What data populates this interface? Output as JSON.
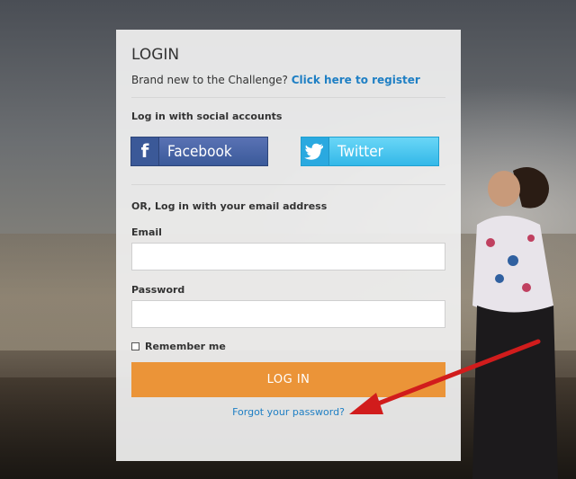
{
  "login": {
    "title": "LOGIN",
    "subtitle_prefix": "Brand new to the Challenge?",
    "register_link": "Click here to register",
    "social_label": "Log in with social accounts",
    "facebook_label": "Facebook",
    "twitter_label": "Twitter",
    "email_section_label": "OR, Log in with your email address",
    "email_label": "Email",
    "email_value": "",
    "password_label": "Password",
    "password_value": "",
    "remember_label": "Remember me",
    "login_button": "LOG IN",
    "forgot_link": "Forgot your password?"
  },
  "colors": {
    "accent_orange": "#eb9438",
    "link_blue": "#1e7fc4",
    "facebook_blue": "#3b5998",
    "twitter_blue": "#33b8e8",
    "annotation_arrow": "#d11c1c"
  },
  "icons": [
    "facebook-icon",
    "twitter-bird-icon",
    "checkbox-icon",
    "red-arrow-annotation"
  ]
}
